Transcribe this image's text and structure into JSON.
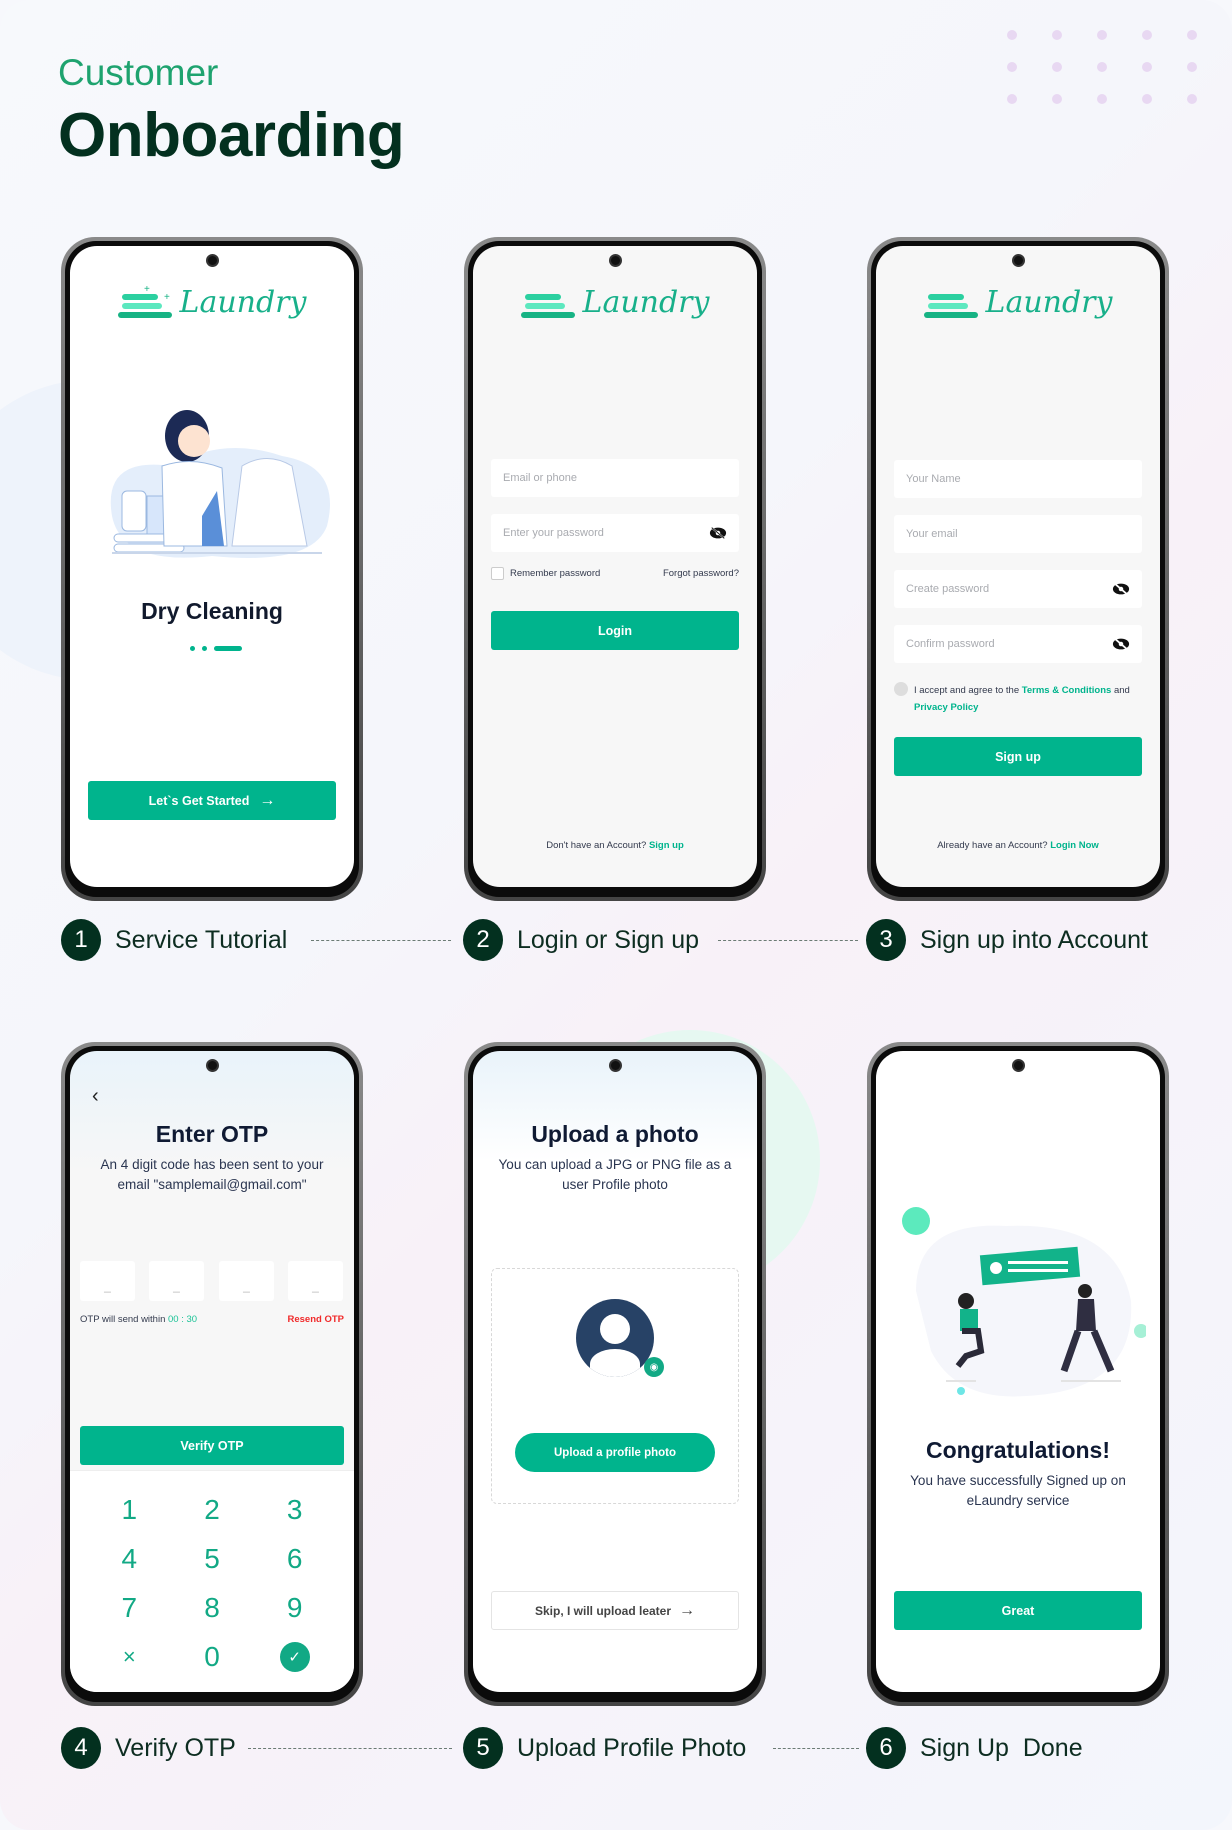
{
  "header": {
    "subtitle": "Customer",
    "title": "Onboarding"
  },
  "colors": {
    "accent": "#00b48d",
    "dark": "#03301f",
    "danger": "#f02a2a",
    "avatar": "#274266"
  },
  "brand": {
    "logo_text": "Laundry"
  },
  "steps": [
    {
      "number": "1",
      "label": "Service Tutorial"
    },
    {
      "number": "2",
      "label": "Login or Sign up"
    },
    {
      "number": "3",
      "label": "Sign up into Account"
    },
    {
      "number": "4",
      "label": "Verify OTP"
    },
    {
      "number": "5",
      "label": "Upload Profile Photo"
    },
    {
      "number": "6",
      "label": "Sign Up  Done"
    }
  ],
  "screen1": {
    "heading": "Dry Cleaning",
    "illustration": "woman-ironing-shirt-illustration",
    "carousel": {
      "total": 3,
      "active": 3
    },
    "cta": "Let`s Get Started"
  },
  "screen2": {
    "email_placeholder": "Email or phone",
    "password_placeholder": "Enter your password",
    "remember": "Remember password",
    "forgot": "Forgot password?",
    "login": "Login",
    "footer_text": "Don't have an Account?",
    "footer_link": "Sign up"
  },
  "screen3": {
    "name_placeholder": "Your Name",
    "email_placeholder": "Your email",
    "create_placeholder": "Create password",
    "confirm_placeholder": "Confirm password",
    "terms_prefix": "I accept and agree to the",
    "terms_link": "Terms  & Conditions",
    "terms_and": "and",
    "privacy_link": "Privacy Policy",
    "signup": "Sign up",
    "footer_text": "Already have an Account?",
    "footer_link": "Login Now"
  },
  "screen4": {
    "heading": "Enter OTP",
    "description": "An 4 digit code has been sent to your email \"samplemail@gmail.com\"",
    "otp_digits": [
      "_",
      "_",
      "_",
      "_"
    ],
    "timer_text": "OTP will send within",
    "timer_value": "00 : 30",
    "resend": "Resend OTP",
    "verify": "Verify OTP",
    "keypad": [
      "1",
      "2",
      "3",
      "4",
      "5",
      "6",
      "7",
      "8",
      "9",
      "×",
      "0"
    ]
  },
  "screen5": {
    "heading": "Upload a photo",
    "description": "You can upload a JPG or PNG file as a user Profile photo",
    "upload_button": "Upload a profile photo",
    "skip": "Skip, I will upload leater"
  },
  "screen6": {
    "heading": "Congratulations!",
    "description": "You have successfully Signed up on eLaundry service",
    "button": "Great",
    "illustration": "celebration-illustration"
  }
}
